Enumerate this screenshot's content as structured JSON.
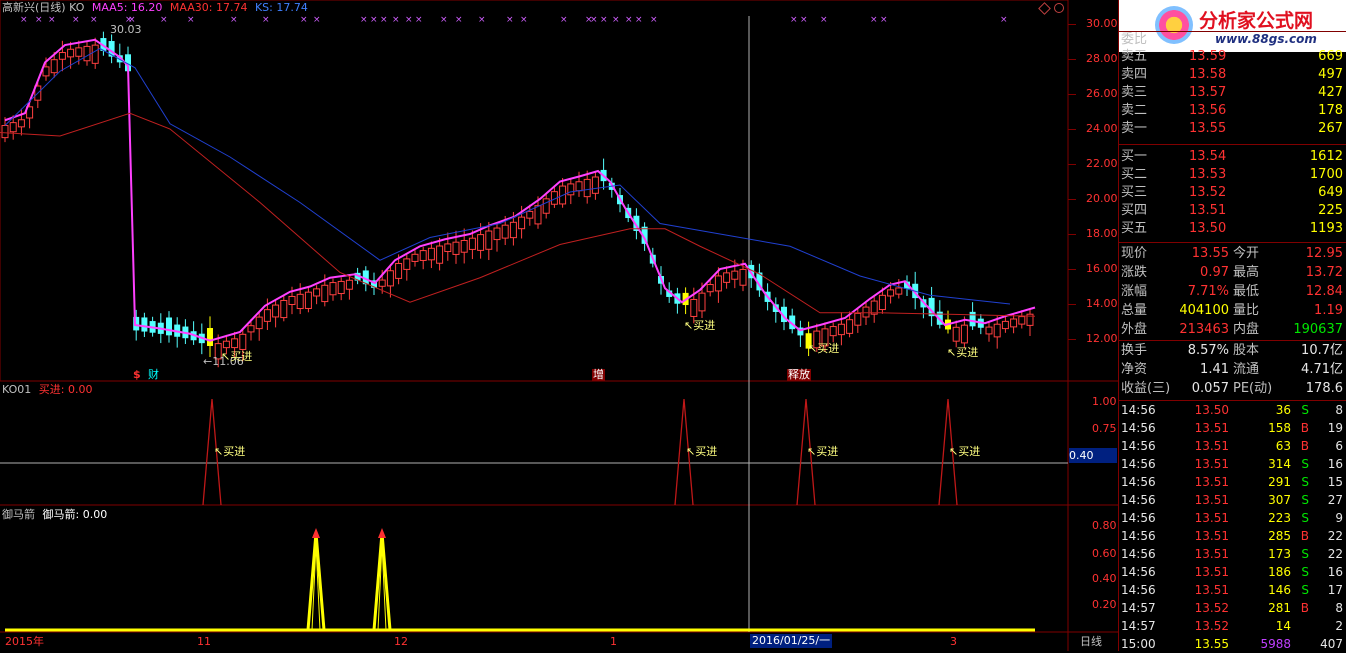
{
  "main_header": {
    "stock": "高新兴(日线) KO",
    "maa5": "MAA5: 16.20",
    "maa30": "MAA30: 17.74",
    "ks": "KS: 17.74",
    "high_label": "30.03",
    "low_label": "←11.06"
  },
  "main_axis": [
    "30.00",
    "28.00",
    "26.00",
    "24.00",
    "22.00",
    "20.00",
    "18.00",
    "16.00",
    "14.00",
    "12.00"
  ],
  "buy_label": "买进",
  "event_marks": [
    "$",
    "财",
    "增",
    "释放"
  ],
  "ko_header": {
    "name": "KO01",
    "value": "买进: 0.00"
  },
  "ko_axis": [
    "1.00",
    "0.75"
  ],
  "ko_cursor_value": "0.40",
  "yma_header": {
    "name": "御马箭",
    "value": "御马箭: 0.00"
  },
  "yma_axis": [
    "0.80",
    "0.60",
    "0.40",
    "0.20"
  ],
  "date_axis": [
    "2015年",
    "11",
    "12",
    "1",
    "2016/01/25/一",
    "3"
  ],
  "period_button": "日线",
  "logo": {
    "title": "分析家公式网",
    "url": "www.88gs.com"
  },
  "chart_data": {
    "type": "candlestick",
    "ylim": [
      11,
      31
    ],
    "ylabel": "",
    "title": "",
    "buy_signals": 4,
    "peak_high": 30.03,
    "trough_low": 11.06
  },
  "order_book": {
    "header": "委比",
    "asks": [
      {
        "label": "卖五",
        "price": "13.59",
        "vol": "669"
      },
      {
        "label": "卖四",
        "price": "13.58",
        "vol": "497"
      },
      {
        "label": "卖三",
        "price": "13.57",
        "vol": "427"
      },
      {
        "label": "卖二",
        "price": "13.56",
        "vol": "178"
      },
      {
        "label": "卖一",
        "price": "13.55",
        "vol": "267"
      }
    ],
    "bids": [
      {
        "label": "买一",
        "price": "13.54",
        "vol": "1612"
      },
      {
        "label": "买二",
        "price": "13.53",
        "vol": "1700"
      },
      {
        "label": "买三",
        "price": "13.52",
        "vol": "649"
      },
      {
        "label": "买四",
        "price": "13.51",
        "vol": "225"
      },
      {
        "label": "买五",
        "price": "13.50",
        "vol": "1193"
      }
    ]
  },
  "quote": [
    {
      "l1": "现价",
      "v1": "13.55",
      "c1": "red",
      "l2": "今开",
      "v2": "12.95",
      "c2": "red"
    },
    {
      "l1": "涨跌",
      "v1": "0.97",
      "c1": "red",
      "l2": "最高",
      "v2": "13.72",
      "c2": "red"
    },
    {
      "l1": "涨幅",
      "v1": "7.71%",
      "c1": "red",
      "l2": "最低",
      "v2": "12.84",
      "c2": "red"
    },
    {
      "l1": "总量",
      "v1": "404100",
      "c1": "yel",
      "l2": "量比",
      "v2": "1.19",
      "c2": "red"
    },
    {
      "l1": "外盘",
      "v1": "213463",
      "c1": "red",
      "l2": "内盘",
      "v2": "190637",
      "c2": "grn"
    }
  ],
  "stats": [
    {
      "l1": "换手",
      "v1": "8.57%",
      "l2": "股本",
      "v2": "10.7亿"
    },
    {
      "l1": "净资",
      "v1": "1.41",
      "l2": "流通",
      "v2": "4.71亿"
    },
    {
      "l1": "收益(三)",
      "v1": "0.057",
      "l2": "PE(动)",
      "v2": "178.6"
    }
  ],
  "ticks": [
    {
      "time": "14:56",
      "price": "13.50",
      "vol": "36",
      "side": "S",
      "n": "8"
    },
    {
      "time": "14:56",
      "price": "13.51",
      "vol": "158",
      "side": "B",
      "n": "19"
    },
    {
      "time": "14:56",
      "price": "13.51",
      "vol": "63",
      "side": "B",
      "n": "6"
    },
    {
      "time": "14:56",
      "price": "13.51",
      "vol": "314",
      "side": "S",
      "n": "16"
    },
    {
      "time": "14:56",
      "price": "13.51",
      "vol": "291",
      "side": "S",
      "n": "15"
    },
    {
      "time": "14:56",
      "price": "13.51",
      "vol": "307",
      "side": "S",
      "n": "27"
    },
    {
      "time": "14:56",
      "price": "13.51",
      "vol": "223",
      "side": "S",
      "n": "9"
    },
    {
      "time": "14:56",
      "price": "13.51",
      "vol": "285",
      "side": "B",
      "n": "22"
    },
    {
      "time": "14:56",
      "price": "13.51",
      "vol": "173",
      "side": "S",
      "n": "22"
    },
    {
      "time": "14:56",
      "price": "13.51",
      "vol": "186",
      "side": "S",
      "n": "16"
    },
    {
      "time": "14:56",
      "price": "13.51",
      "vol": "146",
      "side": "S",
      "n": "17"
    },
    {
      "time": "14:57",
      "price": "13.52",
      "vol": "281",
      "side": "B",
      "n": "8"
    },
    {
      "time": "14:57",
      "price": "13.52",
      "vol": "14",
      "side": "",
      "n": "2"
    },
    {
      "time": "15:00",
      "price": "13.55",
      "vol": "5988",
      "side": "",
      "n": "407"
    }
  ]
}
